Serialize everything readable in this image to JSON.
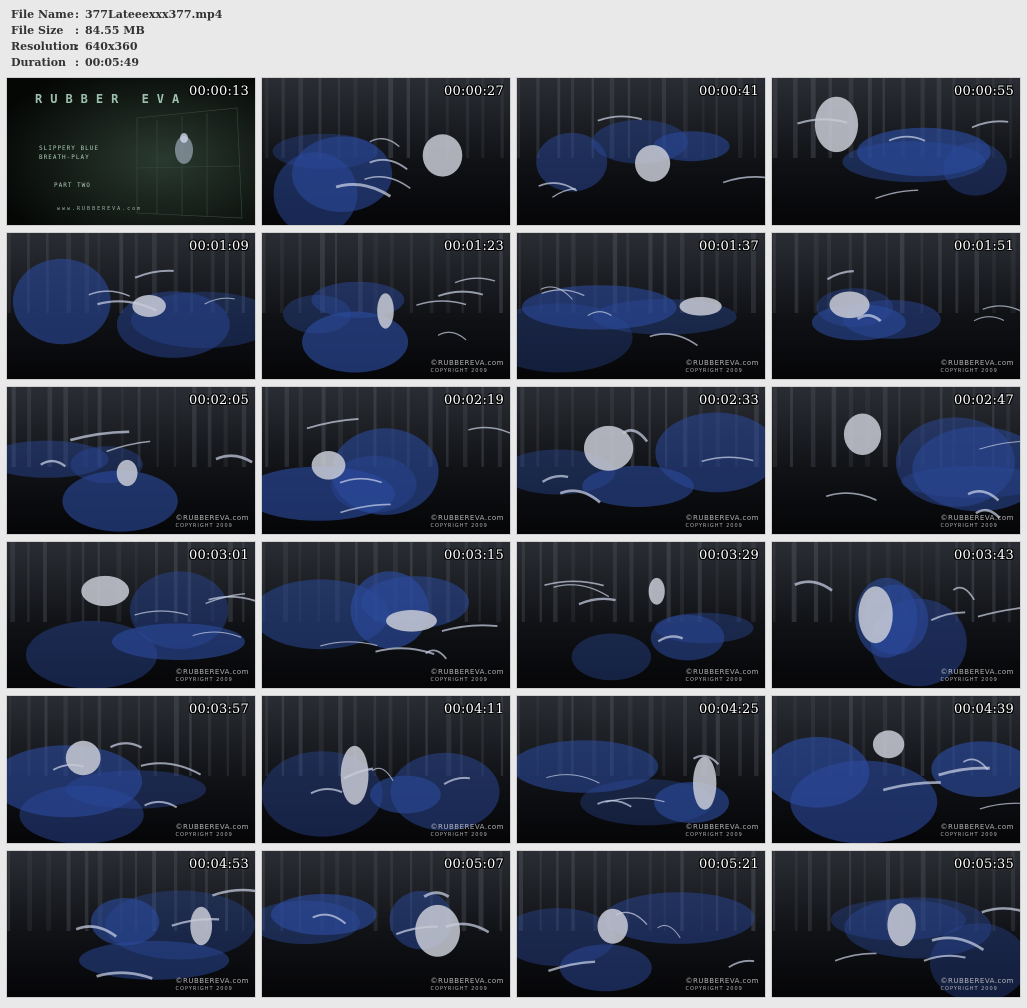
{
  "info": {
    "file_name_label": "File Name",
    "file_name": "377Lateeexxx377.mp4",
    "file_size_label": "File Size",
    "file_size": "84.55 MB",
    "resolution_label": "Resolution",
    "resolution": "640x360",
    "duration_label": "Duration",
    "duration": "00:05:49",
    "separator": ":"
  },
  "title_card": {
    "brand": "RUBBER EVA",
    "line1": "SLIPPERY BLUE",
    "line2": "BREATH-PLAY",
    "part": "PART TWO",
    "url": "www.RUBBEREVA.com"
  },
  "watermark": {
    "brand": "©RUBBEREVA.com",
    "copyright": "COPYRIGHT 2009"
  },
  "thumbnails": [
    {
      "time": "00:00:13"
    },
    {
      "time": "00:00:27"
    },
    {
      "time": "00:00:41"
    },
    {
      "time": "00:00:55"
    },
    {
      "time": "00:01:09"
    },
    {
      "time": "00:01:23"
    },
    {
      "time": "00:01:37"
    },
    {
      "time": "00:01:51"
    },
    {
      "time": "00:02:05"
    },
    {
      "time": "00:02:19"
    },
    {
      "time": "00:02:33"
    },
    {
      "time": "00:02:47"
    },
    {
      "time": "00:03:01"
    },
    {
      "time": "00:03:15"
    },
    {
      "time": "00:03:29"
    },
    {
      "time": "00:03:43"
    },
    {
      "time": "00:03:57"
    },
    {
      "time": "00:04:11"
    },
    {
      "time": "00:04:25"
    },
    {
      "time": "00:04:39"
    },
    {
      "time": "00:04:53"
    },
    {
      "time": "00:05:07"
    },
    {
      "time": "00:05:21"
    },
    {
      "time": "00:05:35"
    }
  ],
  "colors": {
    "background": "#e9e9e9",
    "info_text": "#333333",
    "timestamp": "#ffffff",
    "latex_blue": "#2b4a9c",
    "highlight": "#cfd6ea"
  }
}
